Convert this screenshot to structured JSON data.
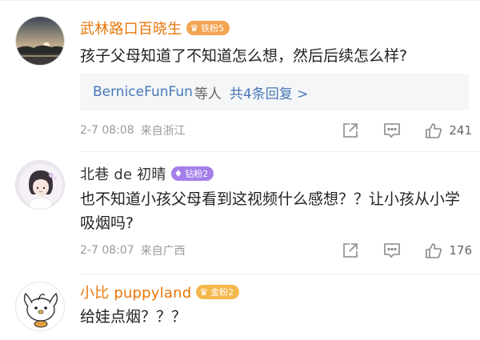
{
  "comments": [
    {
      "username": "武林路口百晓生",
      "badge": "铁粉5",
      "text": "孩子父母知道了不知道怎么想，然后后续怎么样?",
      "replies": {
        "users": "BerniceFunFun",
        "suffix": "等人",
        "count_label": "共4条回复 >"
      },
      "time": "2-7 08:08",
      "location": "来自浙江",
      "likes": "241"
    },
    {
      "username": "北巷 de 初晴",
      "badge": "钻粉2",
      "text": "也不知道小孩父母看到这视频什么感想？？让小孩从小学吸烟吗?",
      "time": "2-7 08:07",
      "location": "来自广西",
      "likes": "176"
    },
    {
      "username": "小比 puppyland",
      "badge": "金粉2",
      "text": "给娃点烟？？？"
    }
  ],
  "colors": {
    "username_orange": "#e8760a",
    "reply_blue": "#4978b8",
    "meta_gray": "#9a9a9a"
  },
  "icons": [
    "forward-icon",
    "comment-icon",
    "like-icon",
    "crown-icon",
    "diamond-icon"
  ]
}
